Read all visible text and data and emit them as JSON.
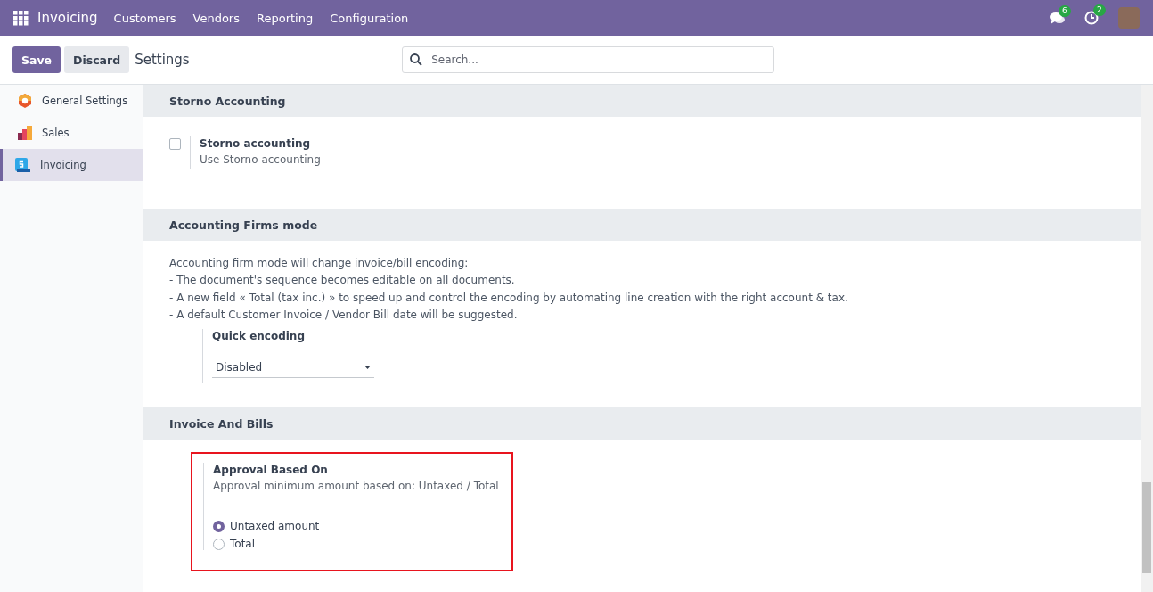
{
  "navbar": {
    "app_name": "Invoicing",
    "menu": [
      "Customers",
      "Vendors",
      "Reporting",
      "Configuration"
    ],
    "messages_count": "6",
    "activities_count": "2"
  },
  "control_panel": {
    "buttons": [
      "Save",
      "Discard"
    ],
    "title": "Settings",
    "search": {
      "placeholder": "Search..."
    }
  },
  "sidebar": {
    "items": [
      {
        "label": "General Settings",
        "selected": false
      },
      {
        "label": "Sales",
        "selected": false
      },
      {
        "label": "Invoicing",
        "selected": true
      }
    ]
  },
  "sections": [
    {
      "title": "Storno Accounting",
      "settings": [
        {
          "kind": "checkbox",
          "label": "Storno accounting",
          "description": "Use Storno accounting",
          "checked": false
        }
      ]
    },
    {
      "title": "Accounting Firms mode",
      "intro": [
        "Accounting firm mode will change invoice/bill encoding:",
        "- The document's sequence becomes editable on all documents.",
        "- A new field « Total (tax inc.) » to speed up and control the encoding by automating line creation with the right account & tax.",
        "- A default Customer Invoice / Vendor Bill date will be suggested."
      ],
      "settings": [
        {
          "kind": "select",
          "label": "Quick encoding",
          "value": "Disabled"
        }
      ]
    },
    {
      "title": "Invoice And Bills",
      "settings": [
        {
          "kind": "radio",
          "label": "Approval Based On",
          "description": "Approval minimum amount based on: Untaxed / Total",
          "highlighted": true,
          "options": [
            {
              "label": "Untaxed amount",
              "selected": true
            },
            {
              "label": "Total",
              "selected": false
            }
          ]
        }
      ]
    }
  ]
}
